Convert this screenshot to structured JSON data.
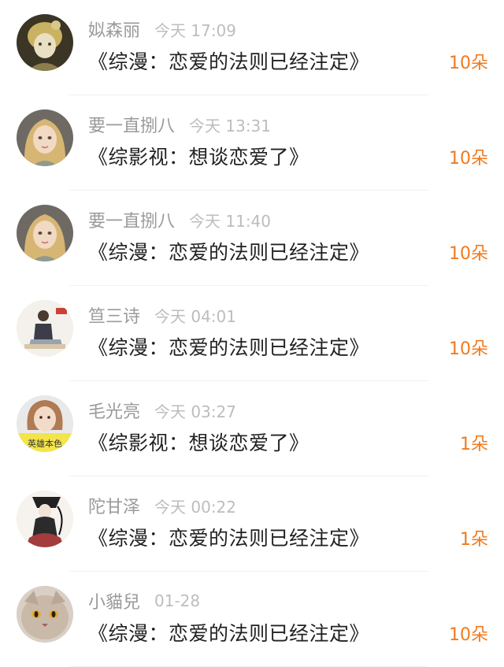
{
  "gift_records": [
    {
      "user": "姒森丽",
      "time": "今天 17:09",
      "work": "《综漫：恋爱的法则已经注定》",
      "amount": "10朵",
      "avatar": "avatar-dark-yellow"
    },
    {
      "user": "要一直捌八",
      "time": "今天 13:31",
      "work": "《综影视：想谈恋爱了》",
      "amount": "10朵",
      "avatar": "avatar-blonde-girl"
    },
    {
      "user": "要一直捌八",
      "time": "今天 11:40",
      "work": "《综漫：恋爱的法则已经注定》",
      "amount": "10朵",
      "avatar": "avatar-blonde-girl"
    },
    {
      "user": "笪三诗",
      "time": "今天 04:01",
      "work": "《综漫：恋爱的法则已经注定》",
      "amount": "10朵",
      "avatar": "avatar-sitting-figure"
    },
    {
      "user": "毛光亮",
      "time": "今天 03:27",
      "work": "《综影视：想谈恋爱了》",
      "amount": "1朵",
      "avatar": "avatar-yellow-banner"
    },
    {
      "user": "陀甘泽",
      "time": "今天 00:22",
      "work": "《综漫：恋爱的法则已经注定》",
      "amount": "1朵",
      "avatar": "avatar-ink-dancer"
    },
    {
      "user": "小貓兒",
      "time": "01-28",
      "work": "《综漫：恋爱的法则已经注定》",
      "amount": "10朵",
      "avatar": "avatar-cat"
    }
  ],
  "avatar_banner_text": "英雄本色",
  "colors": {
    "name": "#9a9a9a",
    "time": "#bdbdbd",
    "title": "#222222",
    "amount": "#f07a1e",
    "divider": "#f1f1f1"
  }
}
